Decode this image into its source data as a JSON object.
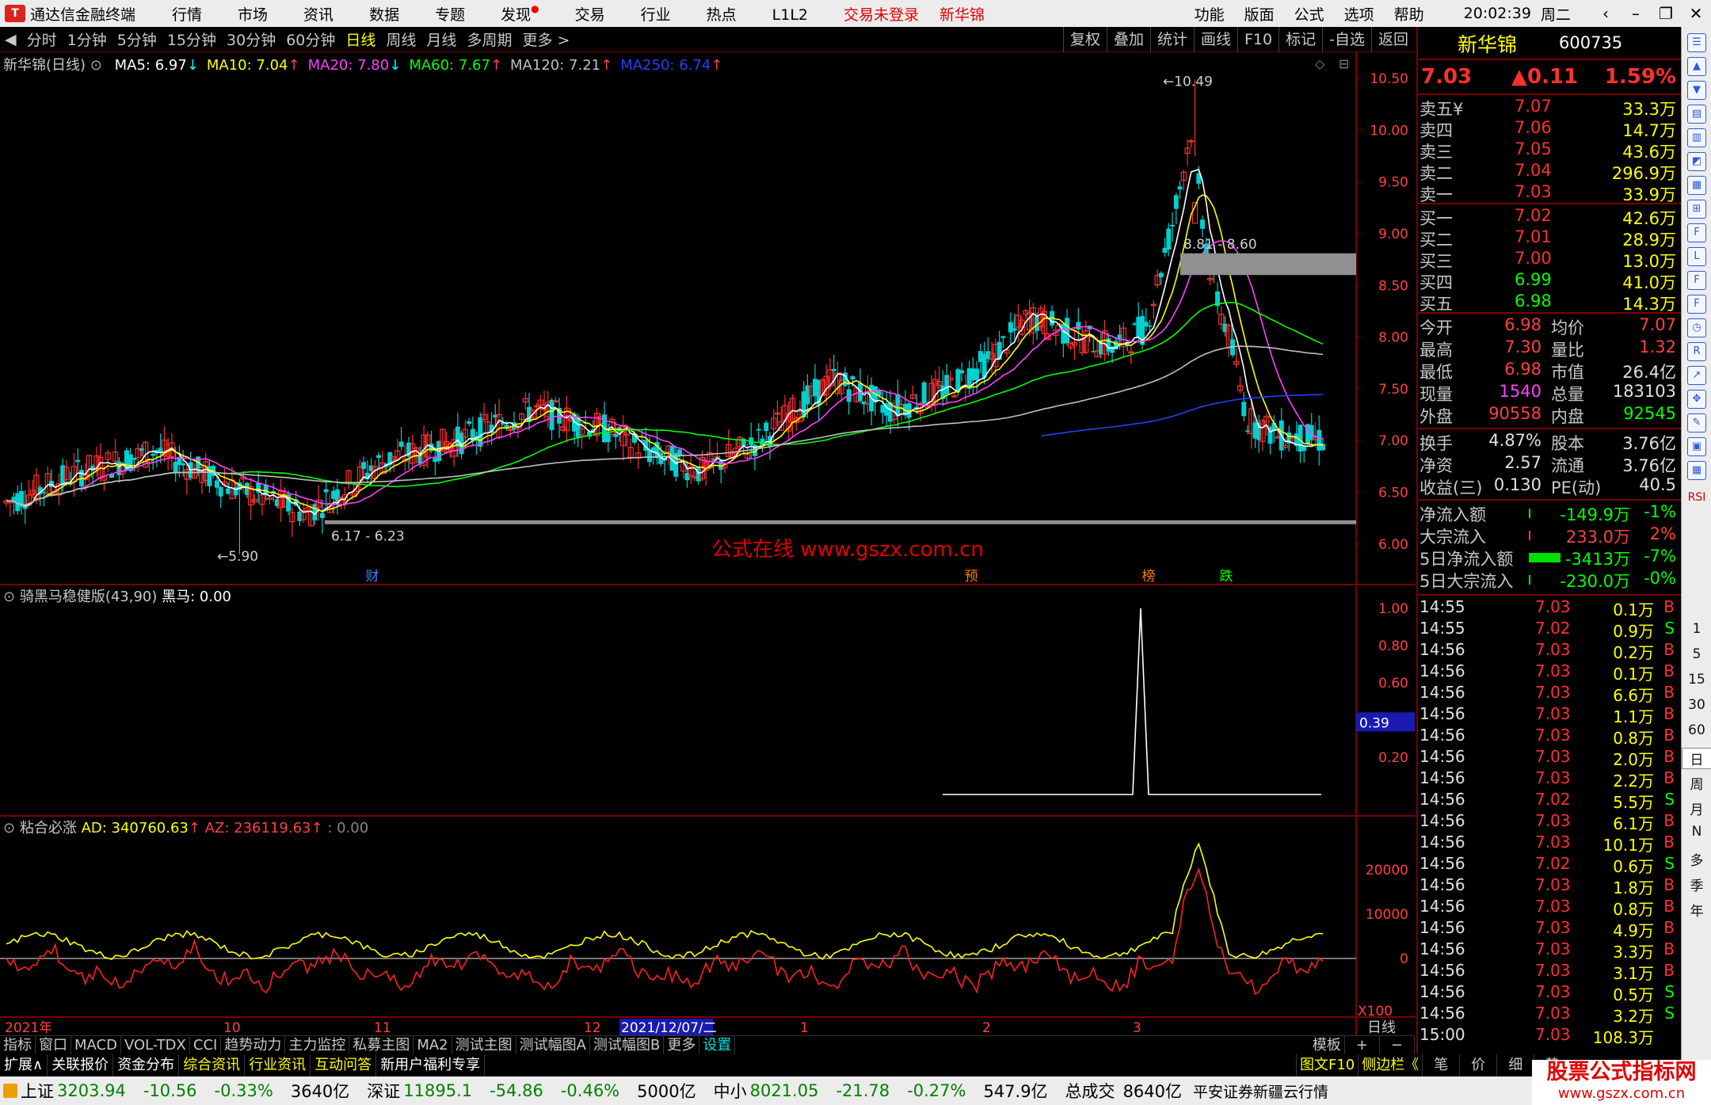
{
  "window": {
    "app_title": "通达信金融终端",
    "menu": [
      "行情",
      "市场",
      "资讯",
      "数据",
      "专题",
      "发现",
      "交易",
      "行业",
      "热点",
      "L1L2"
    ],
    "trade_status": "交易未登录",
    "stock_title": "新华锦",
    "right_menu": [
      "功能",
      "版面",
      "公式",
      "选项",
      "帮助"
    ],
    "clock": "20:02:39",
    "weekday": "周二"
  },
  "periods": {
    "items": [
      "分时",
      "1分钟",
      "5分钟",
      "15分钟",
      "30分钟",
      "60分钟",
      "日线",
      "周线",
      "月线",
      "多周期",
      "更多 >"
    ],
    "active": "日线",
    "right_buttons": [
      "复权",
      "叠加",
      "统计",
      "画线",
      "F10",
      "标记",
      "-自选",
      "返回"
    ]
  },
  "main_chart": {
    "title": "新华锦(日线)",
    "ma": [
      {
        "label": "MA5: 6.97",
        "arrow": "↓",
        "color": "#ffffff"
      },
      {
        "label": "MA10: 7.04",
        "arrow": "↑",
        "color": "#ffff00"
      },
      {
        "label": "MA20: 7.80",
        "arrow": "↓",
        "color": "#ff40ff"
      },
      {
        "label": "MA60: 7.67",
        "arrow": "↑",
        "color": "#00ff00"
      },
      {
        "label": "MA120: 7.21",
        "arrow": "↑",
        "color": "#c0c0c0"
      },
      {
        "label": "MA250: 6.74",
        "arrow": "↑",
        "color": "#2040ff"
      }
    ],
    "y_ticks": [
      "10.50",
      "10.00",
      "9.50",
      "9.00",
      "8.50",
      "8.00",
      "7.50",
      "7.00",
      "6.50",
      "6.00"
    ],
    "y_min": 5.7,
    "y_max": 10.6,
    "high_label": "10.49",
    "low_label": "5.90",
    "zone_upper_label": "8.81 - 8.60",
    "zone_lower_label": "6.17 - 6.23",
    "watermark": "公式在线  www.gszx.com.cn",
    "events": [
      "财",
      "预",
      "榜",
      "跌"
    ]
  },
  "indicator1": {
    "title": "骑黑马稳健版(43,90)",
    "value_label": "黑马: 0.00",
    "y_ticks": [
      "1.00",
      "0.80",
      "0.60",
      "0.40",
      "0.20"
    ],
    "cursor_value": "0.39"
  },
  "indicator2": {
    "title": "粘合必涨",
    "ad_label": "AD: 340760.63",
    "az_label": "AZ: 236119.63",
    "zero_label": ": 0.00",
    "y_ticks": [
      "20000",
      "10000",
      "0"
    ],
    "multiplier": "X100"
  },
  "time_axis": {
    "labels": [
      "2021年",
      "10",
      "11",
      "12",
      "2021/12/07/二",
      "1",
      "2",
      "3"
    ],
    "period": "日线"
  },
  "quote": {
    "name": "新华锦",
    "code": "600735",
    "price": "7.03",
    "change": "▲0.11",
    "pct": "1.59%",
    "sells": [
      {
        "label": "卖五¥",
        "price": "7.07",
        "vol": "33.3万"
      },
      {
        "label": "卖四",
        "price": "7.06",
        "vol": "14.7万"
      },
      {
        "label": "卖三",
        "price": "7.05",
        "vol": "43.6万"
      },
      {
        "label": "卖二",
        "price": "7.04",
        "vol": "296.9万"
      },
      {
        "label": "卖一",
        "price": "7.03",
        "vol": "33.9万"
      }
    ],
    "buys": [
      {
        "label": "买一",
        "price": "7.02",
        "vol": "42.6万"
      },
      {
        "label": "买二",
        "price": "7.01",
        "vol": "28.9万"
      },
      {
        "label": "买三",
        "price": "7.00",
        "vol": "13.0万"
      },
      {
        "label": "买四",
        "price": "6.99",
        "vol": "41.0万"
      },
      {
        "label": "买五",
        "price": "6.98",
        "vol": "14.3万"
      }
    ],
    "stats": [
      {
        "l1": "今开",
        "v1": "6.98",
        "c1": "#ff4040",
        "l2": "均价",
        "v2": "7.07",
        "c2": "#ff4040"
      },
      {
        "l1": "最高",
        "v1": "7.30",
        "c1": "#ff4040",
        "l2": "量比",
        "v2": "1.32",
        "c2": "#ff4040"
      },
      {
        "l1": "最低",
        "v1": "6.98",
        "c1": "#ff4040",
        "l2": "市值",
        "v2": "26.4亿",
        "c2": "#e0e0e0"
      },
      {
        "l1": "现量",
        "v1": "1540",
        "c1": "#ff40ff",
        "l2": "总量",
        "v2": "183103",
        "c2": "#e0e0e0"
      },
      {
        "l1": "外盘",
        "v1": "90558",
        "c1": "#ff4040",
        "l2": "内盘",
        "v2": "92545",
        "c2": "#00ff00"
      }
    ],
    "stats2": [
      {
        "l1": "换手",
        "v1": "4.87%",
        "l2": "股本",
        "v2": "3.76亿"
      },
      {
        "l1": "净资",
        "v1": "2.57",
        "l2": "流通",
        "v2": "3.76亿"
      },
      {
        "l1": "收益(三)",
        "v1": "0.130",
        "l2": "PE(动)",
        "v2": "40.5"
      }
    ],
    "flows": [
      {
        "label": "净流入额",
        "value": "-149.9万",
        "pct": "-1%",
        "vc": "#00ff00",
        "pc": "#00ff00",
        "bar": 0
      },
      {
        "label": "大宗流入",
        "value": "233.0万",
        "pct": "2%",
        "vc": "#ff4040",
        "pc": "#ff4040",
        "bar": 0
      },
      {
        "label": "5日净流入额",
        "value": "-3413万",
        "pct": "-7%",
        "vc": "#00ff00",
        "pc": "#00ff00",
        "bar": 1
      },
      {
        "label": "5日大宗流入",
        "value": "-230.0万",
        "pct": "-0%",
        "vc": "#00ff00",
        "pc": "#00ff00",
        "bar": 0
      }
    ],
    "ticks": [
      {
        "t": "14:55",
        "p": "7.03",
        "v": "0.1万",
        "s": "B"
      },
      {
        "t": "14:55",
        "p": "7.02",
        "v": "0.9万",
        "s": "S"
      },
      {
        "t": "14:56",
        "p": "7.03",
        "v": "0.2万",
        "s": "B"
      },
      {
        "t": "14:56",
        "p": "7.03",
        "v": "0.1万",
        "s": "B"
      },
      {
        "t": "14:56",
        "p": "7.03",
        "v": "6.6万",
        "s": "B"
      },
      {
        "t": "14:56",
        "p": "7.03",
        "v": "1.1万",
        "s": "B"
      },
      {
        "t": "14:56",
        "p": "7.03",
        "v": "0.8万",
        "s": "B"
      },
      {
        "t": "14:56",
        "p": "7.03",
        "v": "2.0万",
        "s": "B"
      },
      {
        "t": "14:56",
        "p": "7.03",
        "v": "2.2万",
        "s": "B"
      },
      {
        "t": "14:56",
        "p": "7.02",
        "v": "5.5万",
        "s": "S"
      },
      {
        "t": "14:56",
        "p": "7.03",
        "v": "6.1万",
        "s": "B"
      },
      {
        "t": "14:56",
        "p": "7.03",
        "v": "10.1万",
        "s": "B"
      },
      {
        "t": "14:56",
        "p": "7.02",
        "v": "0.6万",
        "s": "S"
      },
      {
        "t": "14:56",
        "p": "7.03",
        "v": "1.8万",
        "s": "B"
      },
      {
        "t": "14:56",
        "p": "7.03",
        "v": "0.8万",
        "s": "B"
      },
      {
        "t": "14:56",
        "p": "7.03",
        "v": "4.9万",
        "s": "B"
      },
      {
        "t": "14:56",
        "p": "7.03",
        "v": "3.3万",
        "s": "B"
      },
      {
        "t": "14:56",
        "p": "7.03",
        "v": "3.1万",
        "s": "B"
      },
      {
        "t": "14:56",
        "p": "7.03",
        "v": "0.5万",
        "s": "S"
      },
      {
        "t": "14:56",
        "p": "7.03",
        "v": "3.2万",
        "s": "S"
      },
      {
        "t": "15:00",
        "p": "7.03",
        "v": "108.3万",
        "s": ""
      }
    ]
  },
  "sidebar": {
    "icons": [
      "list-icon",
      "up-icon",
      "down-icon",
      "chart-icon",
      "kline-icon",
      "line-icon",
      "bar-icon",
      "table-icon",
      "f10-icon",
      "l2-icon",
      "f1-icon",
      "f2-icon",
      "clock-icon",
      "rsi-icon",
      "trend-icon",
      "move-icon",
      "pen-icon",
      "grid-icon",
      "calc-icon"
    ],
    "rsi": "RSI",
    "periods": [
      "1",
      "5",
      "15",
      "30",
      "60",
      "日",
      "周",
      "月",
      "N",
      "多",
      "季",
      "年"
    ]
  },
  "bottom_tabs": {
    "items": [
      "指标",
      "窗口",
      "MACD",
      "VOL-TDX",
      "CCI",
      "趋势动力",
      "主力监控",
      "私募主图",
      "MA2",
      "测试主图",
      "测试幅图A",
      "测试幅图B",
      "更多",
      "设置"
    ],
    "active": "设置",
    "template": "模板",
    "plus": "+",
    "minus": "−"
  },
  "bottom_tabs2": {
    "items": [
      {
        "label": "扩展∧",
        "color": "#ffffff"
      },
      {
        "label": "关联报价",
        "color": "#ffffff"
      },
      {
        "label": "资金分布",
        "color": "#ffffff"
      },
      {
        "label": "综合资讯",
        "color": "#ffff00"
      },
      {
        "label": "行业资讯",
        "color": "#ffff00"
      },
      {
        "label": "互动问答",
        "color": "#ffff00"
      },
      {
        "label": "新用户福利专享",
        "color": "#ffffff"
      }
    ],
    "right": [
      "图文F10",
      "侧边栏《",
      "笔",
      "价",
      "细",
      "势"
    ]
  },
  "status": {
    "indices": [
      {
        "name": "上证",
        "value": "3203.94",
        "chg": "-10.56",
        "pct": "-0.33%",
        "amt": "3640亿"
      },
      {
        "name": "深证",
        "value": "11895.1",
        "chg": "-54.86",
        "pct": "-0.46%",
        "amt": "5000亿"
      },
      {
        "name": "中小",
        "value": "8021.05",
        "chg": "-21.78",
        "pct": "-0.27%",
        "amt": "547.9亿"
      }
    ],
    "total_label": "总成交",
    "total": "8640亿",
    "broker": "平安证券新疆云行情",
    "brand": "股票公式指标网",
    "brand_url": "www.gszx.com.cn"
  },
  "colors": {
    "up": "#ff3030",
    "down": "#00d0d0",
    "grid": "#7a0000"
  }
}
